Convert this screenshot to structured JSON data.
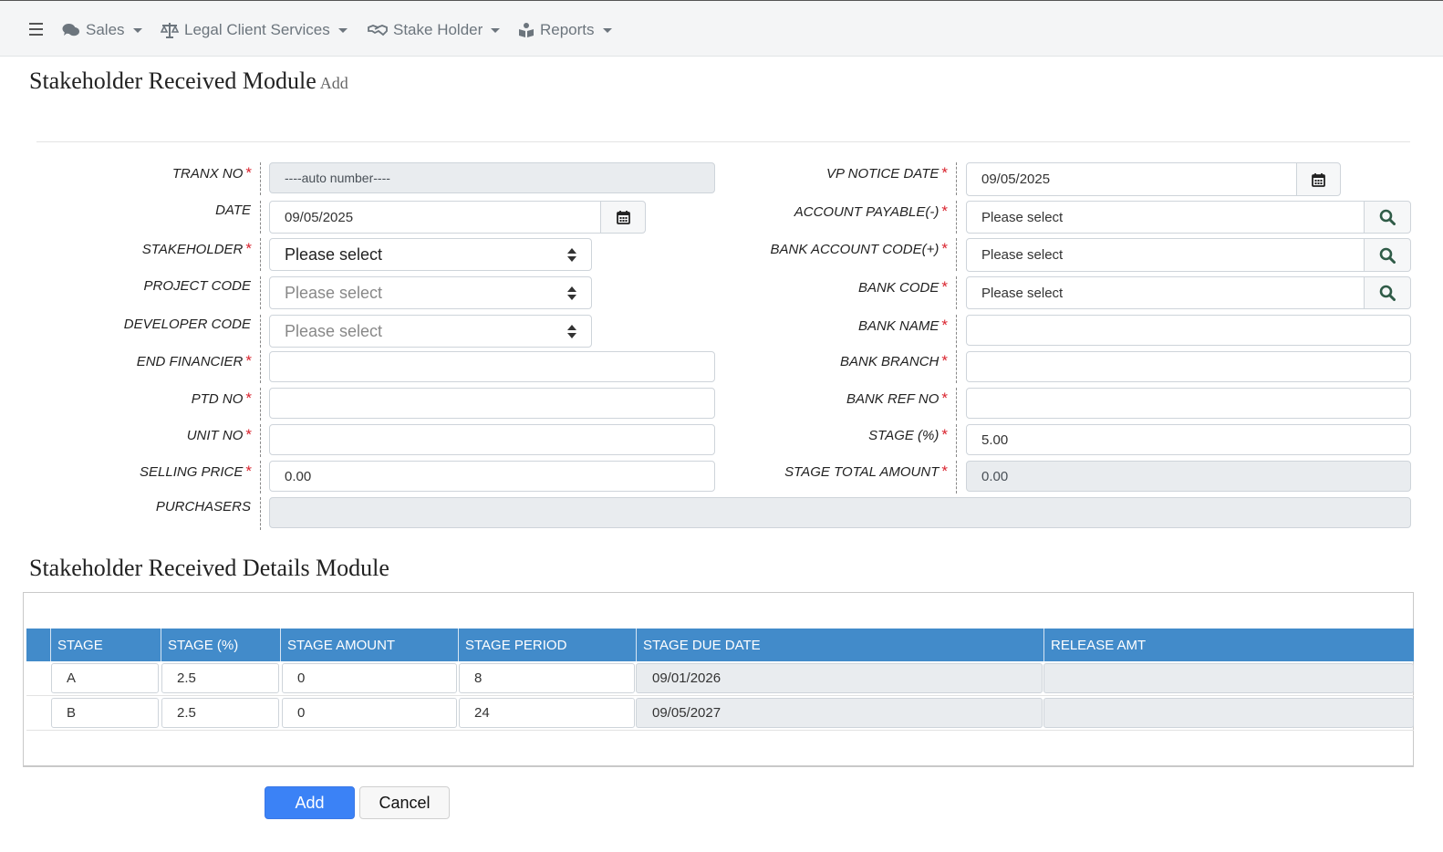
{
  "nav": {
    "menu_icon": "hamburger-icon",
    "items": [
      {
        "label": "Sales",
        "icon": "chat-bubbles-icon"
      },
      {
        "label": "Legal Client Services",
        "icon": "scales-icon"
      },
      {
        "label": "Stake Holder",
        "icon": "handshake-icon"
      },
      {
        "label": "Reports",
        "icon": "reader-icon"
      }
    ]
  },
  "page": {
    "title": "Stakeholder Received Module",
    "subtitle": "Add"
  },
  "form": {
    "left": {
      "tranx_no": {
        "label": "TRANX NO",
        "value": "----auto number----"
      },
      "date": {
        "label": "DATE",
        "value": "09/05/2025"
      },
      "stakeholder": {
        "label": "STAKEHOLDER",
        "value": "Please select"
      },
      "project_code": {
        "label": "PROJECT CODE",
        "value": "Please select"
      },
      "developer_code": {
        "label": "DEVELOPER CODE",
        "value": "Please select"
      },
      "end_financier": {
        "label": "END FINANCIER",
        "value": ""
      },
      "ptd_no": {
        "label": "PTD NO",
        "value": ""
      },
      "unit_no": {
        "label": "UNIT NO",
        "value": ""
      },
      "selling_price": {
        "label": "SELLING PRICE",
        "value": "0.00"
      },
      "purchasers": {
        "label": "PURCHASERS",
        "value": ""
      }
    },
    "right": {
      "vp_notice_date": {
        "label": "VP NOTICE DATE",
        "value": "09/05/2025"
      },
      "account_payable": {
        "label": "ACCOUNT PAYABLE(-)",
        "value": "Please select"
      },
      "bank_account_code": {
        "label": "BANK ACCOUNT CODE(+)",
        "value": "Please select"
      },
      "bank_code": {
        "label": "BANK CODE",
        "value": "Please select"
      },
      "bank_name": {
        "label": "BANK NAME",
        "value": ""
      },
      "bank_branch": {
        "label": "BANK BRANCH",
        "value": ""
      },
      "bank_ref_no": {
        "label": "BANK REF NO",
        "value": ""
      },
      "stage_pct": {
        "label": "STAGE (%)",
        "value": "5.00"
      },
      "stage_total_amount": {
        "label": "STAGE TOTAL AMOUNT",
        "value": "0.00"
      }
    },
    "required_mark": "*"
  },
  "details": {
    "title": "Stakeholder Received Details Module",
    "columns": [
      "STAGE",
      "STAGE (%)",
      "STAGE AMOUNT",
      "STAGE PERIOD",
      "STAGE DUE DATE",
      "RELEASE AMT"
    ],
    "rows": [
      {
        "stage": "A",
        "stage_pct": "2.5",
        "stage_amount": "0",
        "stage_period": "8",
        "stage_due_date": "09/01/2026",
        "release_amt": ""
      },
      {
        "stage": "B",
        "stage_pct": "2.5",
        "stage_amount": "0",
        "stage_period": "24",
        "stage_due_date": "09/05/2027",
        "release_amt": ""
      }
    ]
  },
  "buttons": {
    "add": "Add",
    "cancel": "Cancel"
  },
  "colors": {
    "table_header": "#428bca",
    "primary_button": "#3b82f6",
    "required": "#d9232e"
  }
}
